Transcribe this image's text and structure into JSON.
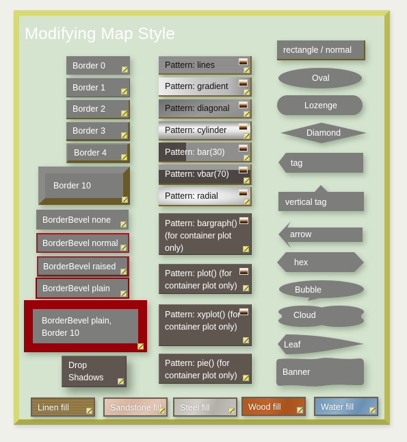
{
  "title": "Modifying Map Style",
  "col1": {
    "borders": [
      "Border 0",
      "Border 1",
      "Border 2",
      "Border 3",
      "Border 4",
      "Border 10"
    ],
    "bevels": [
      "BorderBevel none",
      "BorderBevel normal",
      "BorderBevel raised",
      "BorderBevel plain"
    ],
    "bevel_plain_10": "BorderBevel plain, Border 10",
    "drop_shadows": "Drop Shadows"
  },
  "col2": {
    "patterns": [
      "Pattern: lines",
      "Pattern: gradient",
      "Pattern: diagonal",
      "Pattern: cylinder",
      "Pattern: bar(30)",
      "Pattern: vbar(70)",
      "Pattern: radial"
    ],
    "container_patterns": [
      "Pattern: bargraph() (for container plot only)",
      "Pattern: plot() (for container plot only)",
      "Pattern: xyplot() (for container plot only)",
      "Pattern: pie() (for container plot only)"
    ],
    "bar_fill_percent": 30,
    "vbar_fill_percent": 70
  },
  "col3": {
    "shapes": [
      "rectangle / normal",
      "Oval",
      "Lozenge",
      "Diamond",
      "tag",
      "vertical tag",
      "arrow",
      "hex",
      "Bubble",
      "Cloud",
      "Leaf",
      "Banner"
    ]
  },
  "fills": [
    "Linen fill",
    "Sandstone fill",
    "Steel fill",
    "Wood fill",
    "Water fill"
  ],
  "colors": {
    "background": "#d4e4cf",
    "frame": "#d8da70",
    "node_gray": "#7d7d7b",
    "node_brown": "#5f5650",
    "bevel_red": "#9a0008"
  }
}
